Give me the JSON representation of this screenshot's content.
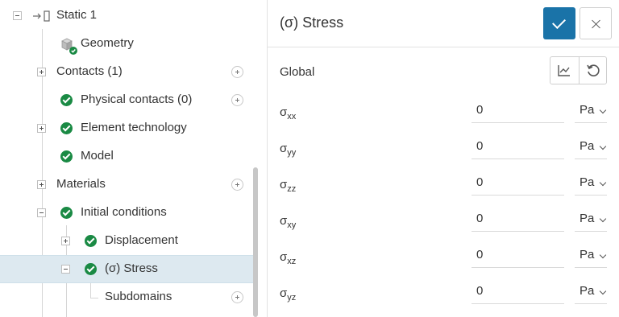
{
  "tree": {
    "items": [
      {
        "label": "Static 1"
      },
      {
        "label": "Geometry"
      },
      {
        "label": "Contacts (1)"
      },
      {
        "label": "Physical contacts (0)"
      },
      {
        "label": "Element technology"
      },
      {
        "label": "Model"
      },
      {
        "label": "Materials"
      },
      {
        "label": "Initial conditions"
      },
      {
        "label": "Displacement"
      },
      {
        "label": "(σ) Stress"
      },
      {
        "label": "Subdomains"
      }
    ]
  },
  "panel": {
    "title": "(σ) Stress",
    "section_label": "Global",
    "fields": [
      {
        "symbol": "σ",
        "subscript": "xx",
        "value": "0",
        "unit": "Pa"
      },
      {
        "symbol": "σ",
        "subscript": "yy",
        "value": "0",
        "unit": "Pa"
      },
      {
        "symbol": "σ",
        "subscript": "zz",
        "value": "0",
        "unit": "Pa"
      },
      {
        "symbol": "σ",
        "subscript": "xy",
        "value": "0",
        "unit": "Pa"
      },
      {
        "symbol": "σ",
        "subscript": "xz",
        "value": "0",
        "unit": "Pa"
      },
      {
        "symbol": "σ",
        "subscript": "yz",
        "value": "0",
        "unit": "Pa"
      }
    ]
  },
  "colors": {
    "accent": "#1a73a8",
    "check_green": "#1a8a44",
    "selected_row": "#dde9f0"
  },
  "icons": {
    "confirm": "checkmark-icon",
    "close": "close-icon",
    "chart": "chart-icon",
    "reset": "reset-icon",
    "status": "check-circle-icon",
    "add": "add-circle-icon"
  }
}
